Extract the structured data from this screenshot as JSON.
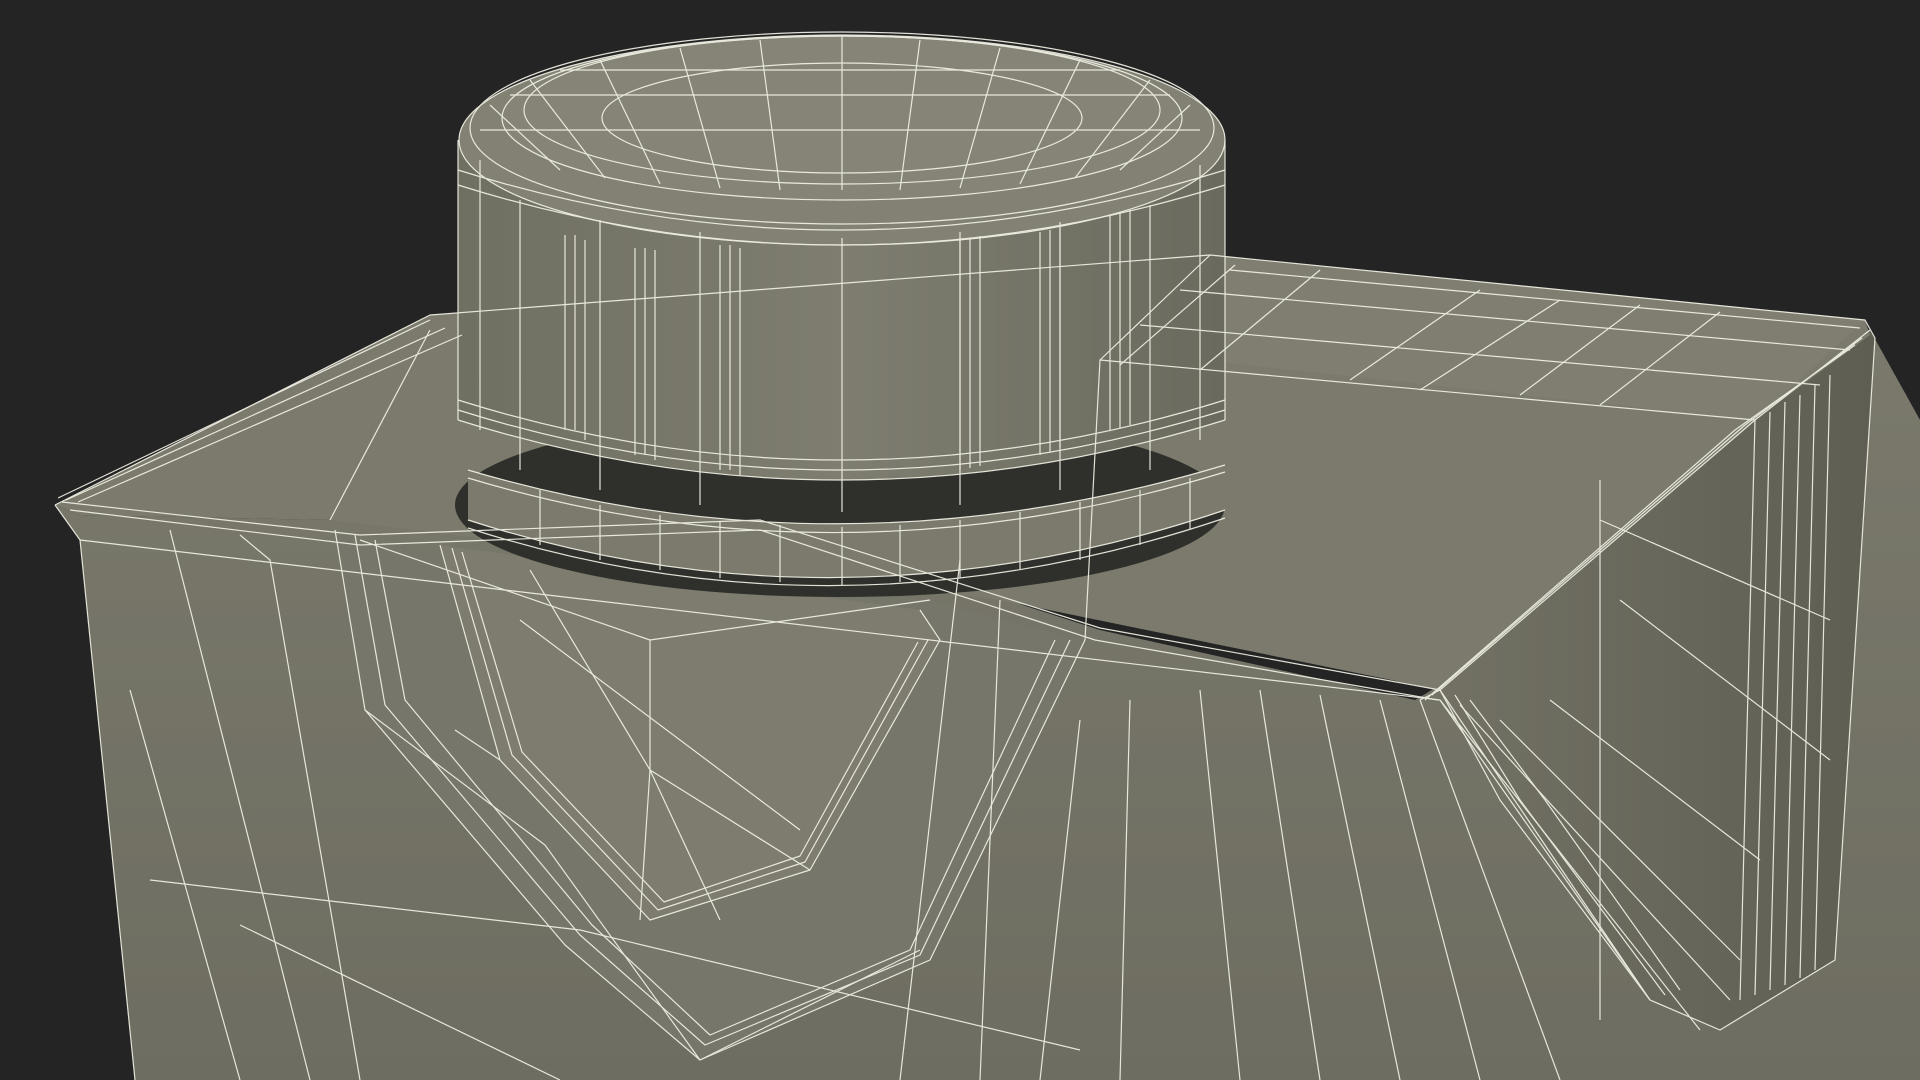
{
  "viewport": {
    "background_color": "#242424",
    "render_mode": "wireframe-on-shaded",
    "wire_color": "#f2f1e6",
    "surface_colors": {
      "carton_front": "#767568",
      "carton_top": "#7b7a6d",
      "cap_side": "#7a7a6c",
      "cap_top": "#828174",
      "gap_ring": "#2f302b"
    }
  },
  "model": {
    "subject": "carton-with-screw-cap",
    "parts": [
      "carton-body",
      "carton-top",
      "spout-flap",
      "screw-cap",
      "cap-grip-ribs",
      "tamper-ring"
    ]
  }
}
